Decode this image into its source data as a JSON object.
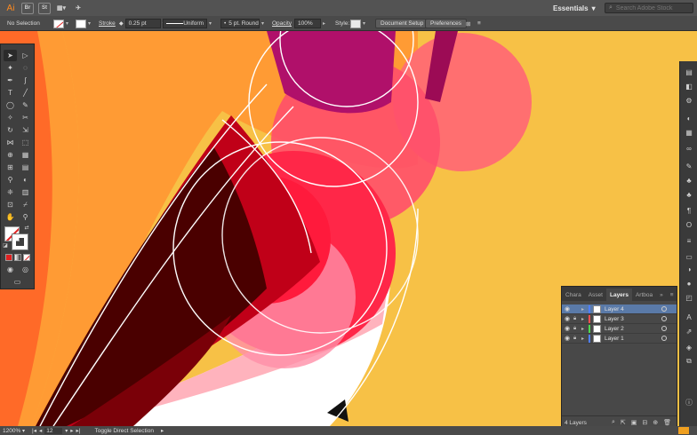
{
  "appbar": {
    "logo": "Ai",
    "bridge": "Br",
    "stock_app": "St",
    "workspace": "Essentials",
    "stock_search_placeholder": "Search Adobe Stock"
  },
  "controlbar": {
    "selection": "No Selection",
    "stroke_label": "Stroke",
    "stroke_weight": "0.25 pt",
    "profile": "Uniform",
    "brush": "5 pt. Round",
    "opacity_label": "Opacity",
    "opacity_value": "100%",
    "style_label": "Style:",
    "document_setup": "Document Setup",
    "preferences": "Preferences"
  },
  "layers_panel": {
    "tabs": [
      {
        "label": "Chara"
      },
      {
        "label": "Asset"
      },
      {
        "label": "Layers"
      },
      {
        "label": "Artboa"
      }
    ],
    "layers": [
      {
        "name": "Layer 4",
        "color": "#4f7fff",
        "active": true
      },
      {
        "name": "Layer 3",
        "color": "#ff4f4f",
        "active": false
      },
      {
        "name": "Layer 2",
        "color": "#4fd84f",
        "active": false
      },
      {
        "name": "Layer 1",
        "color": "#4f7fff",
        "active": false
      }
    ],
    "count": "4 Layers"
  },
  "status": {
    "zoom": "1200%",
    "artboard": "12",
    "tool_hint": "Toggle Direct Selection"
  },
  "colors": {
    "canvas_bg": "#f7c146",
    "orange": "#ff9b34",
    "deep_orange": "#ff6a28",
    "red": "#ff2040",
    "dark_red": "#4a0000",
    "magenta": "#b0106a",
    "pink": "#ff8fa0"
  }
}
